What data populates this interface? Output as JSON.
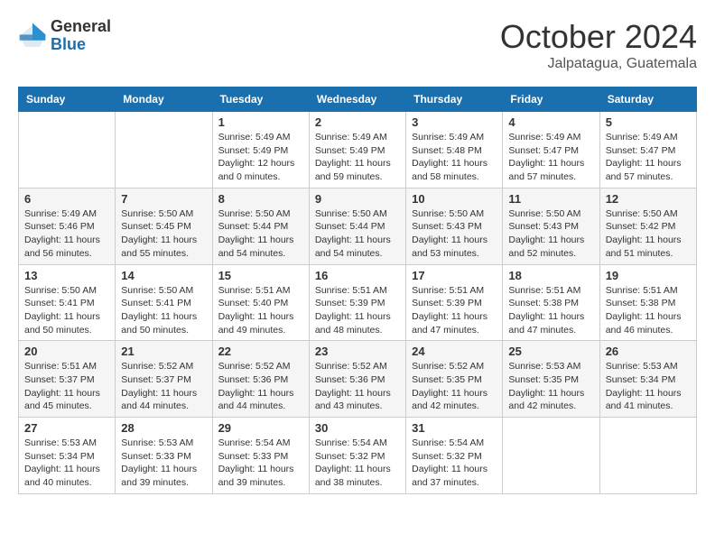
{
  "logo": {
    "general": "General",
    "blue": "Blue"
  },
  "title": "October 2024",
  "location": "Jalpatagua, Guatemala",
  "weekdays": [
    "Sunday",
    "Monday",
    "Tuesday",
    "Wednesday",
    "Thursday",
    "Friday",
    "Saturday"
  ],
  "weeks": [
    [
      null,
      null,
      {
        "day": "1",
        "sunrise": "Sunrise: 5:49 AM",
        "sunset": "Sunset: 5:49 PM",
        "daylight": "Daylight: 12 hours and 0 minutes."
      },
      {
        "day": "2",
        "sunrise": "Sunrise: 5:49 AM",
        "sunset": "Sunset: 5:49 PM",
        "daylight": "Daylight: 11 hours and 59 minutes."
      },
      {
        "day": "3",
        "sunrise": "Sunrise: 5:49 AM",
        "sunset": "Sunset: 5:48 PM",
        "daylight": "Daylight: 11 hours and 58 minutes."
      },
      {
        "day": "4",
        "sunrise": "Sunrise: 5:49 AM",
        "sunset": "Sunset: 5:47 PM",
        "daylight": "Daylight: 11 hours and 57 minutes."
      },
      {
        "day": "5",
        "sunrise": "Sunrise: 5:49 AM",
        "sunset": "Sunset: 5:47 PM",
        "daylight": "Daylight: 11 hours and 57 minutes."
      }
    ],
    [
      {
        "day": "6",
        "sunrise": "Sunrise: 5:49 AM",
        "sunset": "Sunset: 5:46 PM",
        "daylight": "Daylight: 11 hours and 56 minutes."
      },
      {
        "day": "7",
        "sunrise": "Sunrise: 5:50 AM",
        "sunset": "Sunset: 5:45 PM",
        "daylight": "Daylight: 11 hours and 55 minutes."
      },
      {
        "day": "8",
        "sunrise": "Sunrise: 5:50 AM",
        "sunset": "Sunset: 5:44 PM",
        "daylight": "Daylight: 11 hours and 54 minutes."
      },
      {
        "day": "9",
        "sunrise": "Sunrise: 5:50 AM",
        "sunset": "Sunset: 5:44 PM",
        "daylight": "Daylight: 11 hours and 54 minutes."
      },
      {
        "day": "10",
        "sunrise": "Sunrise: 5:50 AM",
        "sunset": "Sunset: 5:43 PM",
        "daylight": "Daylight: 11 hours and 53 minutes."
      },
      {
        "day": "11",
        "sunrise": "Sunrise: 5:50 AM",
        "sunset": "Sunset: 5:43 PM",
        "daylight": "Daylight: 11 hours and 52 minutes."
      },
      {
        "day": "12",
        "sunrise": "Sunrise: 5:50 AM",
        "sunset": "Sunset: 5:42 PM",
        "daylight": "Daylight: 11 hours and 51 minutes."
      }
    ],
    [
      {
        "day": "13",
        "sunrise": "Sunrise: 5:50 AM",
        "sunset": "Sunset: 5:41 PM",
        "daylight": "Daylight: 11 hours and 50 minutes."
      },
      {
        "day": "14",
        "sunrise": "Sunrise: 5:50 AM",
        "sunset": "Sunset: 5:41 PM",
        "daylight": "Daylight: 11 hours and 50 minutes."
      },
      {
        "day": "15",
        "sunrise": "Sunrise: 5:51 AM",
        "sunset": "Sunset: 5:40 PM",
        "daylight": "Daylight: 11 hours and 49 minutes."
      },
      {
        "day": "16",
        "sunrise": "Sunrise: 5:51 AM",
        "sunset": "Sunset: 5:39 PM",
        "daylight": "Daylight: 11 hours and 48 minutes."
      },
      {
        "day": "17",
        "sunrise": "Sunrise: 5:51 AM",
        "sunset": "Sunset: 5:39 PM",
        "daylight": "Daylight: 11 hours and 47 minutes."
      },
      {
        "day": "18",
        "sunrise": "Sunrise: 5:51 AM",
        "sunset": "Sunset: 5:38 PM",
        "daylight": "Daylight: 11 hours and 47 minutes."
      },
      {
        "day": "19",
        "sunrise": "Sunrise: 5:51 AM",
        "sunset": "Sunset: 5:38 PM",
        "daylight": "Daylight: 11 hours and 46 minutes."
      }
    ],
    [
      {
        "day": "20",
        "sunrise": "Sunrise: 5:51 AM",
        "sunset": "Sunset: 5:37 PM",
        "daylight": "Daylight: 11 hours and 45 minutes."
      },
      {
        "day": "21",
        "sunrise": "Sunrise: 5:52 AM",
        "sunset": "Sunset: 5:37 PM",
        "daylight": "Daylight: 11 hours and 44 minutes."
      },
      {
        "day": "22",
        "sunrise": "Sunrise: 5:52 AM",
        "sunset": "Sunset: 5:36 PM",
        "daylight": "Daylight: 11 hours and 44 minutes."
      },
      {
        "day": "23",
        "sunrise": "Sunrise: 5:52 AM",
        "sunset": "Sunset: 5:36 PM",
        "daylight": "Daylight: 11 hours and 43 minutes."
      },
      {
        "day": "24",
        "sunrise": "Sunrise: 5:52 AM",
        "sunset": "Sunset: 5:35 PM",
        "daylight": "Daylight: 11 hours and 42 minutes."
      },
      {
        "day": "25",
        "sunrise": "Sunrise: 5:53 AM",
        "sunset": "Sunset: 5:35 PM",
        "daylight": "Daylight: 11 hours and 42 minutes."
      },
      {
        "day": "26",
        "sunrise": "Sunrise: 5:53 AM",
        "sunset": "Sunset: 5:34 PM",
        "daylight": "Daylight: 11 hours and 41 minutes."
      }
    ],
    [
      {
        "day": "27",
        "sunrise": "Sunrise: 5:53 AM",
        "sunset": "Sunset: 5:34 PM",
        "daylight": "Daylight: 11 hours and 40 minutes."
      },
      {
        "day": "28",
        "sunrise": "Sunrise: 5:53 AM",
        "sunset": "Sunset: 5:33 PM",
        "daylight": "Daylight: 11 hours and 39 minutes."
      },
      {
        "day": "29",
        "sunrise": "Sunrise: 5:54 AM",
        "sunset": "Sunset: 5:33 PM",
        "daylight": "Daylight: 11 hours and 39 minutes."
      },
      {
        "day": "30",
        "sunrise": "Sunrise: 5:54 AM",
        "sunset": "Sunset: 5:32 PM",
        "daylight": "Daylight: 11 hours and 38 minutes."
      },
      {
        "day": "31",
        "sunrise": "Sunrise: 5:54 AM",
        "sunset": "Sunset: 5:32 PM",
        "daylight": "Daylight: 11 hours and 37 minutes."
      },
      null,
      null
    ]
  ]
}
